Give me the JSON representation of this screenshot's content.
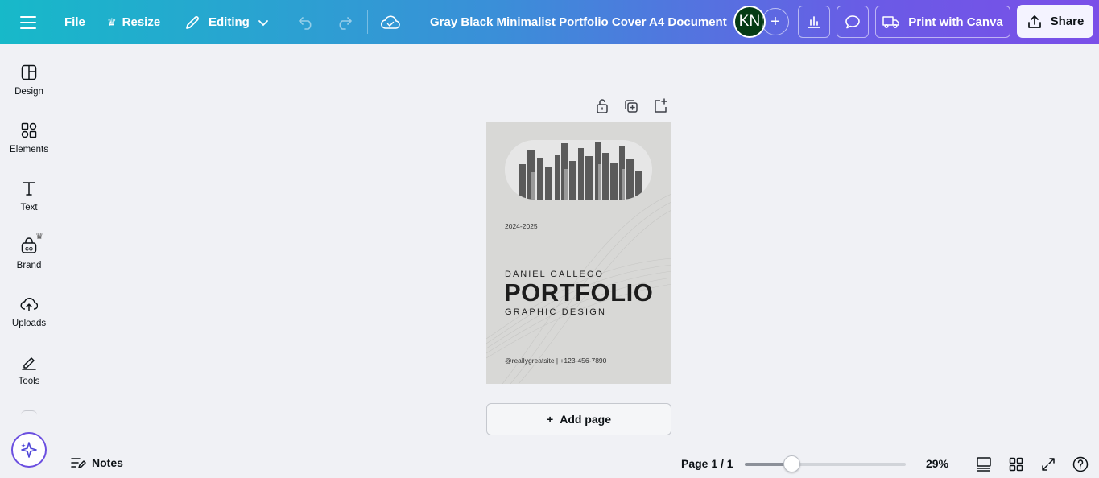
{
  "topbar": {
    "file_label": "File",
    "resize_label": "Resize",
    "editing_label": "Editing",
    "doc_title": "Gray Black Minimalist Portfolio Cover A4 Document",
    "avatar_initials": "KN",
    "print_label": "Print with Canva",
    "share_label": "Share"
  },
  "sidebar": {
    "items": [
      {
        "label": "Design",
        "icon": "design-icon"
      },
      {
        "label": "Elements",
        "icon": "elements-icon"
      },
      {
        "label": "Text",
        "icon": "text-icon"
      },
      {
        "label": "Brand",
        "icon": "brand-icon"
      },
      {
        "label": "Uploads",
        "icon": "uploads-icon"
      },
      {
        "label": "Tools",
        "icon": "tools-icon"
      }
    ]
  },
  "page": {
    "year": "2024-2025",
    "name": "DANIEL GALLEGO",
    "title": "PORTFOLIO",
    "subtitle": "GRAPHIC DESIGN",
    "contact": "@reallygreatsite | +123-456-7890"
  },
  "canvas": {
    "add_page_label": "Add page",
    "add_page_icon": "+"
  },
  "bottombar": {
    "notes_label": "Notes",
    "page_count": "Page 1 / 1",
    "zoom_fraction": 0.29,
    "zoom_label": "29%"
  },
  "colors": {
    "topbar_start": "#17b9c9",
    "topbar_end": "#7a4fe8",
    "avatar_bg": "#053b14",
    "page_bg": "#d8d8d6"
  }
}
